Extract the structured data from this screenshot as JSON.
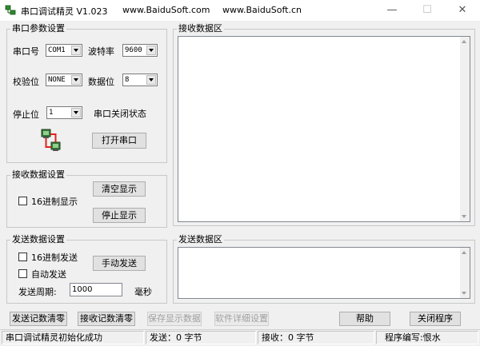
{
  "window": {
    "app_title": "串口调试精灵 V1.023",
    "site_link_1": "www.BaiduSoft.com",
    "site_link_2": "www.BaiduSoft.cn",
    "minimize_glyph": "—",
    "maximize_glyph": "☐",
    "close_glyph": "✕"
  },
  "serial_params": {
    "group_label": "串口参数设置",
    "port_label": "串口号",
    "port_value": "COM1",
    "baud_label": "波特率",
    "baud_value": "9600",
    "parity_label": "校验位",
    "parity_value": "NONE",
    "databits_label": "数据位",
    "databits_value": "8",
    "stopbits_label": "停止位",
    "stopbits_value": "1",
    "port_status": "串口关闭状态",
    "open_button": "打开串口",
    "connection_icon": "serial-connection-icon"
  },
  "receive_settings": {
    "group_label": "接收数据设置",
    "hex_display_label": "16进制显示",
    "hex_display_checked": false,
    "clear_button": "清空显示",
    "stop_button": "停止显示"
  },
  "send_settings": {
    "group_label": "发送数据设置",
    "hex_send_label": "16进制发送",
    "hex_send_checked": false,
    "auto_send_label": "自动发送",
    "auto_send_checked": false,
    "manual_send_button": "手动发送",
    "period_label": "发送周期:",
    "period_value": "1000",
    "period_unit": "毫秒"
  },
  "receive_area": {
    "group_label": "接收数据区",
    "content": ""
  },
  "send_area": {
    "group_label": "发送数据区",
    "content": ""
  },
  "bottom_buttons": {
    "clear_send_log": "发送记数清零",
    "clear_receive_log": "接收记数清零",
    "save_display": "保存显示数据",
    "advanced_settings": "软件详细设置",
    "help": "帮助",
    "close_app": "关闭程序"
  },
  "status_bar": {
    "message": "串口调试精灵初始化成功",
    "sent": "发送：0 字节",
    "received": "接收：0 字节",
    "author": "程序编写:恨水"
  },
  "colors": {
    "background": "#f0f0f0",
    "disabled_text": "#a0a0a0",
    "icon_red": "#e02020"
  }
}
